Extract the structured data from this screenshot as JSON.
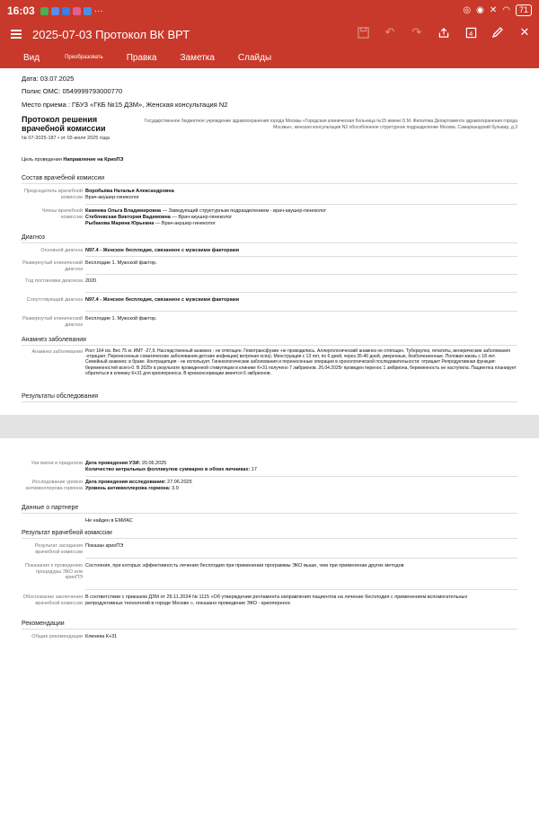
{
  "status_bar": {
    "time": "16:03",
    "battery": "71"
  },
  "toolbar": {
    "title": "2025-07-03 Протокол ВК ВРТ"
  },
  "menu": {
    "items": [
      "Вид",
      "Преобразовать",
      "Правка",
      "Заметка",
      "Слайды"
    ]
  },
  "document": {
    "date": "Дата: 03.07.2025",
    "policy": "Полис ОМС: 0549999793000770",
    "place": "Место приема : ГБУЗ «ГКБ №15 ДЗМ», Женская консультация N2",
    "title": "Протокол решения врачебной комиссии",
    "number": "№ 07-2025-187  • от 03 июля 2025 года",
    "org": "Государственное бюджетное учреждение здравоохранения города Москвы «Городская клиническая больница №15 имени О.М. Филатова Департамента здравоохранения города Москвы», женская консультация N2 обособленное структурное подразделение Москва, Самаркандский бульвар, д.3",
    "goal_label": "Цель проведения",
    "goal_value": "Направление на КриоПЭ",
    "commission_section": "Состав врачебной комиссии",
    "chair_label": "Председатель врачебной комиссии",
    "chair_name": "Воробьёва Наталья Александровна",
    "chair_role": "Врач-акушер-гинеколог",
    "members_label": "Члены врачебной комиссии",
    "member1_name": "Камнева Ольга Владимировна",
    "member1_role": " — Заведующий структурным подразделением - врач-акушер-гинеколог",
    "member2_name": "Стеблевская Виктория Вадимовна",
    "member2_role": " — Врач-акушер-гинеколог",
    "member3_name": "Рыбакова Марина Юрьевна",
    "member3_role": " — Врач-акушер-гинеколог",
    "diagnosis_section": "Диагноз",
    "main_dx_label": "Основной диагноз",
    "main_dx": "N97.4 - Женское бесплодие, связанное с мужскими факторами",
    "ext_dx_label": "Развернутый клинический диагноз",
    "ext_dx": "Бесплодие 1. Мужской фактор.",
    "year_label": "Год постановки диагноза",
    "year": "2020",
    "concomitant_label": "Сопутствующий диагноз",
    "concomitant": "N97.4 - Женское бесплодие, связанное с мужскими факторами",
    "ext_dx2_label": "Развернутый клинический диагноз",
    "ext_dx2": "Бесплодие 1. Мужской фактор.",
    "anamnesis_section": "Анамнез заболевания",
    "anamnesis_label": "Анамнез заболевания",
    "anamnesis": "Рост 164 см. Вес 75 кг. ИМТ -27,9. Наследственный анамнез - не отягощен. Гемотрансфузии -не проводились. Аллергологический анамнез не отягощен. Туберкулез, гепатиты, венерические заболевания -отрицает. Перенесенные соматические заболевания-детские инфекции( ветряная оспа). Менструация с 13 лет, по 6 дней, через 35-40 дней, умеренные, безболезненные. Половая жизнь с 18 лет. Семейный анамнез: в браке. Контрацепция - не использует. Гинекологические заболевания и перенесенные операции в хронологической последовательности: отрицает Репродуктивная функция: беременностей всего-0. В 2025г в результате проведенной стимуляции в клинике К+31 получено 7 эмбрионов.  26.04.2025г проведен перенос 1 эмбриона, беременность не наступила. Пациентка планирует обратиться в клинику К+31 для криопереноса. В криоконсервации имеется 6 эмбрионов.",
    "results_section": "Результаты обследования",
    "us_label": "Узи матки и придатков",
    "us_date_k": "Дата проведения УЗИ:",
    "us_date_v": " 20.06.2025",
    "us_count_k": "Количество антральных фолликулов суммарно в обоих яичниках:",
    "us_count_v": " 17",
    "amh_label": "Исследование уровня антимюллерова гормона",
    "amh_date_k": "Дата проведения исследования:",
    "amh_date_v": " 27.06.2025",
    "amh_level_k": "Уровень антимюллерова гормона:",
    "amh_level_v": " 3.9",
    "partner_section": "Данные о партнере",
    "partner_value": "Не найден в ЕМИАС",
    "result_section": "Результат врачебной комиссии",
    "decision_label": "Результат заседания врачебной комиссии",
    "decision": "Показан криоПЭ",
    "indications_label": "Показания к проведению процедуры ЭКО или криоПЭ",
    "indications": "Состояния, при которых эффективность лечения бесплодия при применении программы ЭКО выше, чем при применении других методов",
    "justification_label": "Обоснование заключения врачебной комиссии",
    "justification": "В соответствии с приказом ДЗМ от 29.11.2024 № 1115 «Об утверждении регламента направления пациентов на лечение бесплодия с применением вспомогательных репродуктивных технологий в городе Москве », показано проведение ЭКО - криоперенос",
    "recommend_section": "Рекомендации",
    "recommend_label": "Общие рекомендации",
    "recommend": "Клиника К+31"
  }
}
